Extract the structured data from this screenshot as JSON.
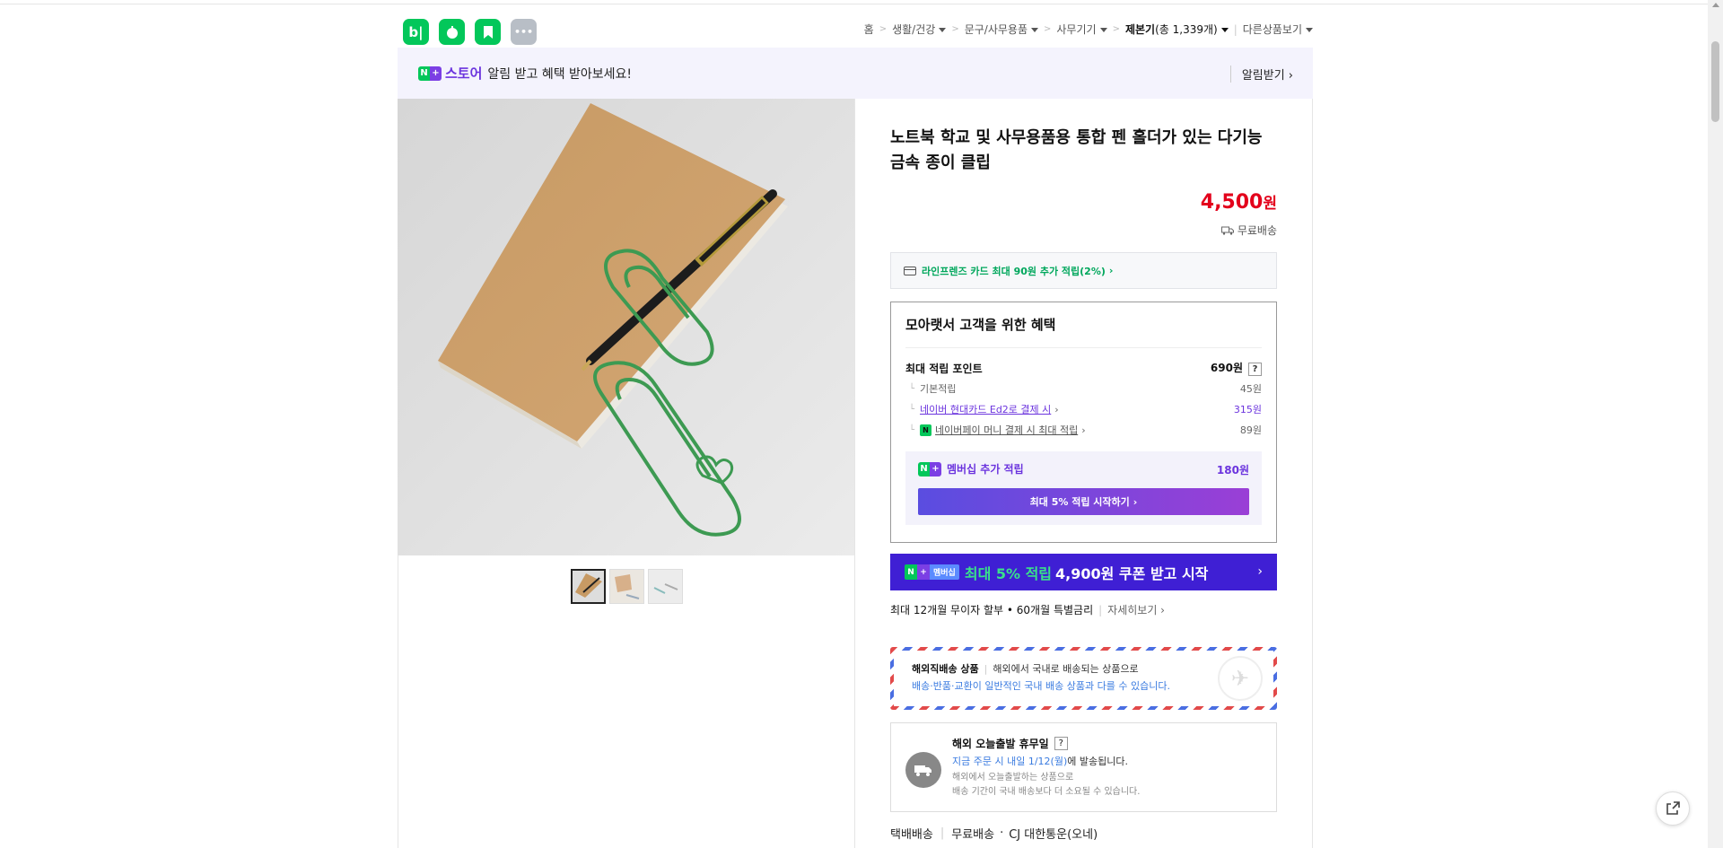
{
  "header": {
    "apps": [
      {
        "label": "b|",
        "color": "#03c75a",
        "icon": "blog-icon"
      },
      {
        "label": "☕",
        "color": "#03c75a",
        "icon": "cafe-icon"
      },
      {
        "label": "✓",
        "color": "#03c75a",
        "icon": "bookmark-icon"
      },
      {
        "label": "•••",
        "color": "#b8bec6",
        "icon": "more-icon"
      }
    ],
    "breadcrumb": {
      "home": "홈",
      "level1": "생활/건강",
      "level2": "문구/사무용품",
      "level3": "사무기기",
      "current": "제본기",
      "count": "(총 1,339개)",
      "other": "다른상품보기"
    }
  },
  "store_bar": {
    "badge_n": "N",
    "badge_plus": "+",
    "store_name": "스토어",
    "message": "알림 받고 혜택 받아보세요!",
    "alarm_button": "알림받기"
  },
  "product": {
    "title": "노트북 학교 및 사무용품용 통합 펜 홀더가 있는 다기능 금속 종이 클립",
    "price": "4,500",
    "currency": "원",
    "shipping": "무료배송",
    "card_benefit": "라인프렌즈 카드 최대 90원 추가 적립(2%)"
  },
  "benefits": {
    "heading": "모아랫서 고객을 위한 혜택",
    "max_points_label": "최대 적립 포인트",
    "max_points_value": "690원",
    "rows": [
      {
        "label": "기본적립",
        "value": "45원"
      },
      {
        "label": "네이버 현대카드 Ed2로 결제 시",
        "value": "315원"
      },
      {
        "label": "네이버페이 머니 결제 시 최대 적립",
        "value": "89원"
      }
    ],
    "npay_icon": "N",
    "membership_label": "멤버십 추가 적립",
    "membership_value": "180원",
    "membership_button": "최대 5% 적립 시작하기"
  },
  "promo": {
    "badge_text": "멤버십",
    "highlight": "최대 5% 적립",
    "text": "4,900원 쿠폰 받고 시작"
  },
  "installment": {
    "text": "최대 12개월 무이자 할부 • 60개월 특별금리",
    "more": "자세히보기"
  },
  "abroad": {
    "title": "해외직배송 상품",
    "desc1": "해외에서 국내로 배송되는 상품으로",
    "desc2": "배송·반품·교환이 일반적인 국내 배송 상품과 다를 수 있습니다."
  },
  "today": {
    "title": "해외 오늘출발 휴무일",
    "order_text_blue": "지금 주문 시 내일 1/12(월)",
    "order_text_rest": "에 발송됩니다.",
    "note1": "해외에서 오늘출발하는 상품으로",
    "note2": "배송 기간이 국내 배송보다 더 소요될 수 있습니다."
  },
  "delivery": {
    "type": "택배배송",
    "fee": "무료배송",
    "carrier": "CJ 대한통운(오네)"
  }
}
